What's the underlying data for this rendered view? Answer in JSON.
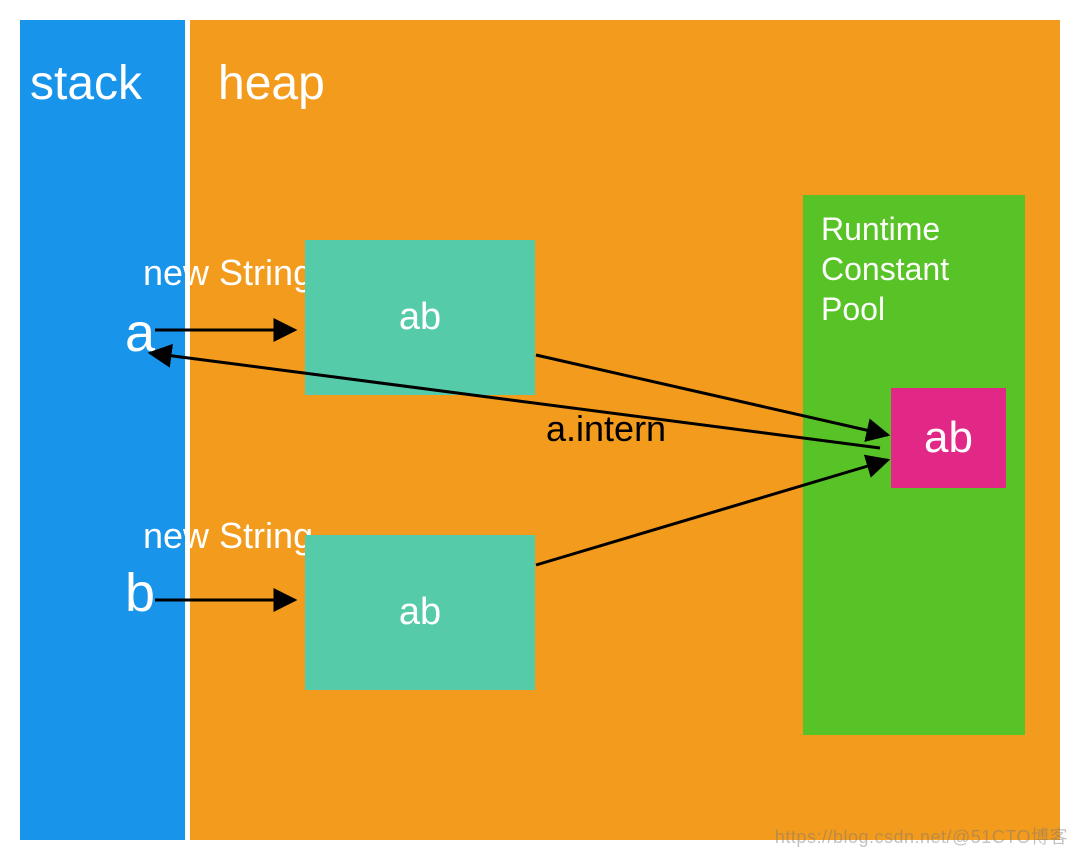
{
  "stack": {
    "title": "stack",
    "var_a": "a",
    "var_b": "b"
  },
  "heap": {
    "title": "heap",
    "obj1": {
      "label": "new String",
      "value": "ab"
    },
    "obj2": {
      "label": "new String",
      "value": "ab"
    },
    "intern_label": "a.intern",
    "pool": {
      "title": "Runtime\nConstant\nPool",
      "value": "ab"
    }
  },
  "watermark": "https://blog.csdn.net/@51CTO博客"
}
